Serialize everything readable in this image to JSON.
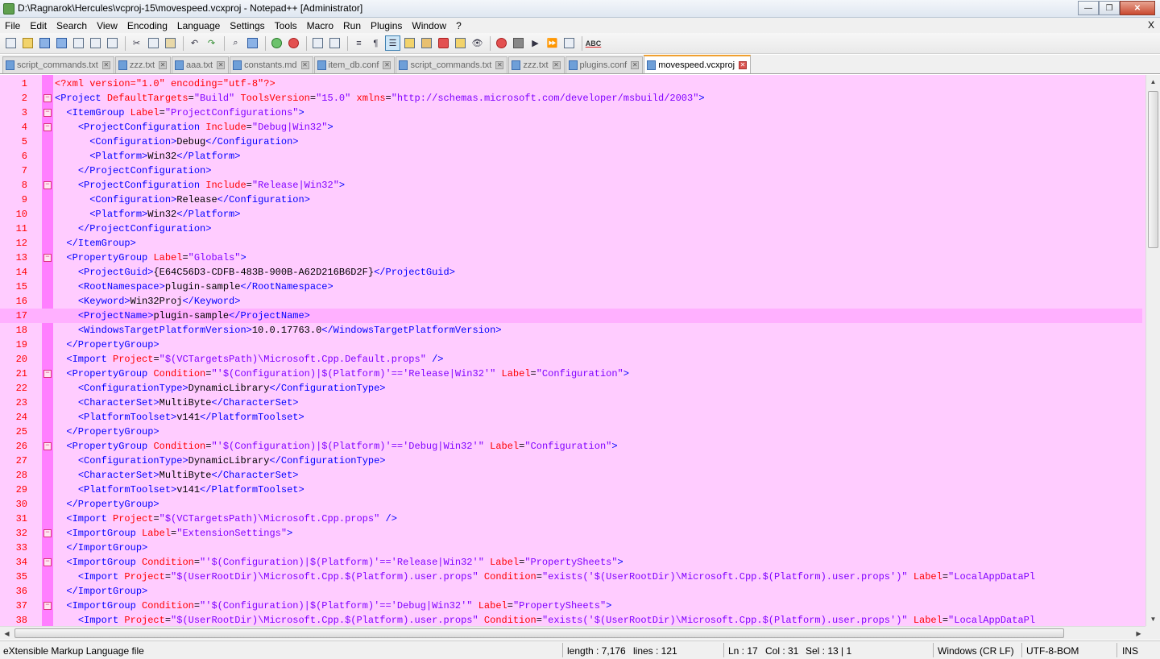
{
  "window": {
    "title": "D:\\Ragnarok\\Hercules\\vcproj-15\\movespeed.vcxproj - Notepad++ [Administrator]",
    "minimize": "—",
    "maximize": "❐",
    "close": "✕"
  },
  "menu": {
    "items": [
      "File",
      "Edit",
      "Search",
      "View",
      "Encoding",
      "Language",
      "Settings",
      "Tools",
      "Macro",
      "Run",
      "Plugins",
      "Window",
      "?"
    ],
    "close_doc": "X"
  },
  "toolbar": {
    "spellcheck_label": "ABC",
    "icons": [
      "new-file-icon",
      "open-file-icon",
      "save-icon",
      "save-all-icon",
      "close-icon",
      "close-all-icon",
      "print-icon",
      "cut-icon",
      "copy-icon",
      "paste-icon",
      "undo-icon",
      "redo-icon",
      "find-icon",
      "replace-icon",
      "zoom-in-icon",
      "zoom-out-icon",
      "sync-vertical-icon",
      "sync-horizontal-icon",
      "word-wrap-icon",
      "show-all-chars-icon",
      "indent-guide-icon",
      "user-language-icon",
      "doc-map-icon",
      "function-list-icon",
      "folder-workspace-icon",
      "monitoring-icon",
      "record-macro-icon",
      "stop-macro-icon",
      "play-macro-icon",
      "run-macro-multiple-icon",
      "save-macro-icon",
      "spell-check-icon"
    ]
  },
  "tabs": [
    {
      "label": "script_commands.txt",
      "active": false
    },
    {
      "label": "zzz.txt",
      "active": false
    },
    {
      "label": "aaa.txt",
      "active": false
    },
    {
      "label": "constants.md",
      "active": false
    },
    {
      "label": "item_db.conf",
      "active": false
    },
    {
      "label": "script_commands.txt",
      "active": false
    },
    {
      "label": "zzz.txt",
      "active": false
    },
    {
      "label": "plugins.conf",
      "active": false
    },
    {
      "label": "movespeed.vcxproj",
      "active": true
    }
  ],
  "editor": {
    "current_line": 17,
    "lines": [
      {
        "n": "1",
        "fold": "",
        "code": [
          [
            "pi",
            "<?xml version=\"1.0\" encoding=\"utf-8\"?>"
          ]
        ]
      },
      {
        "n": "2",
        "fold": "−",
        "code": [
          [
            "tag",
            "<Project "
          ],
          [
            "attr",
            "DefaultTargets"
          ],
          [
            "txt",
            "="
          ],
          [
            "str",
            "\"Build\""
          ],
          [
            "attr",
            " ToolsVersion"
          ],
          [
            "txt",
            "="
          ],
          [
            "str",
            "\"15.0\""
          ],
          [
            "attr",
            " xmlns"
          ],
          [
            "txt",
            "="
          ],
          [
            "str",
            "\"http://schemas.microsoft.com/developer/msbuild/2003\""
          ],
          [
            "tag",
            ">"
          ]
        ]
      },
      {
        "n": "3",
        "fold": "−",
        "code": [
          [
            "txt",
            "  "
          ],
          [
            "tag",
            "<ItemGroup "
          ],
          [
            "attr",
            "Label"
          ],
          [
            "txt",
            "="
          ],
          [
            "str",
            "\"ProjectConfigurations\""
          ],
          [
            "tag",
            ">"
          ]
        ]
      },
      {
        "n": "4",
        "fold": "−",
        "code": [
          [
            "txt",
            "    "
          ],
          [
            "tag",
            "<ProjectConfiguration "
          ],
          [
            "attr",
            "Include"
          ],
          [
            "txt",
            "="
          ],
          [
            "str",
            "\"Debug|Win32\""
          ],
          [
            "tag",
            ">"
          ]
        ]
      },
      {
        "n": "5",
        "fold": "",
        "code": [
          [
            "txt",
            "      "
          ],
          [
            "tag",
            "<Configuration>"
          ],
          [
            "txt",
            "Debug"
          ],
          [
            "tag",
            "</Configuration>"
          ]
        ]
      },
      {
        "n": "6",
        "fold": "",
        "code": [
          [
            "txt",
            "      "
          ],
          [
            "tag",
            "<Platform>"
          ],
          [
            "txt",
            "Win32"
          ],
          [
            "tag",
            "</Platform>"
          ]
        ]
      },
      {
        "n": "7",
        "fold": "",
        "code": [
          [
            "txt",
            "    "
          ],
          [
            "tag",
            "</ProjectConfiguration>"
          ]
        ]
      },
      {
        "n": "8",
        "fold": "−",
        "code": [
          [
            "txt",
            "    "
          ],
          [
            "tag",
            "<ProjectConfiguration "
          ],
          [
            "attr",
            "Include"
          ],
          [
            "txt",
            "="
          ],
          [
            "str",
            "\"Release|Win32\""
          ],
          [
            "tag",
            ">"
          ]
        ]
      },
      {
        "n": "9",
        "fold": "",
        "code": [
          [
            "txt",
            "      "
          ],
          [
            "tag",
            "<Configuration>"
          ],
          [
            "txt",
            "Release"
          ],
          [
            "tag",
            "</Configuration>"
          ]
        ]
      },
      {
        "n": "10",
        "fold": "",
        "code": [
          [
            "txt",
            "      "
          ],
          [
            "tag",
            "<Platform>"
          ],
          [
            "txt",
            "Win32"
          ],
          [
            "tag",
            "</Platform>"
          ]
        ]
      },
      {
        "n": "11",
        "fold": "",
        "code": [
          [
            "txt",
            "    "
          ],
          [
            "tag",
            "</ProjectConfiguration>"
          ]
        ]
      },
      {
        "n": "12",
        "fold": "",
        "code": [
          [
            "txt",
            "  "
          ],
          [
            "tag",
            "</ItemGroup>"
          ]
        ]
      },
      {
        "n": "13",
        "fold": "−",
        "code": [
          [
            "txt",
            "  "
          ],
          [
            "tag",
            "<PropertyGroup "
          ],
          [
            "attr",
            "Label"
          ],
          [
            "txt",
            "="
          ],
          [
            "str",
            "\"Globals\""
          ],
          [
            "tag",
            ">"
          ]
        ]
      },
      {
        "n": "14",
        "fold": "",
        "code": [
          [
            "txt",
            "    "
          ],
          [
            "tag",
            "<ProjectGuid>"
          ],
          [
            "txt",
            "{E64C56D3-CDFB-483B-900B-A62D216B6D2F}"
          ],
          [
            "tag",
            "</ProjectGuid>"
          ]
        ]
      },
      {
        "n": "15",
        "fold": "",
        "code": [
          [
            "txt",
            "    "
          ],
          [
            "tag",
            "<RootNamespace>"
          ],
          [
            "txt",
            "plugin-sample"
          ],
          [
            "tag",
            "</RootNamespace>"
          ]
        ]
      },
      {
        "n": "16",
        "fold": "",
        "code": [
          [
            "txt",
            "    "
          ],
          [
            "tag",
            "<Keyword>"
          ],
          [
            "txt",
            "Win32Proj"
          ],
          [
            "tag",
            "</Keyword>"
          ]
        ]
      },
      {
        "n": "17",
        "fold": "",
        "code": [
          [
            "txt",
            "    "
          ],
          [
            "tag",
            "<ProjectName>"
          ],
          [
            "txt",
            "plugin-sample"
          ],
          [
            "tag",
            "</ProjectName>"
          ]
        ]
      },
      {
        "n": "18",
        "fold": "",
        "code": [
          [
            "txt",
            "    "
          ],
          [
            "tag",
            "<WindowsTargetPlatformVersion>"
          ],
          [
            "txt",
            "10.0.17763.0"
          ],
          [
            "tag",
            "</WindowsTargetPlatformVersion>"
          ]
        ]
      },
      {
        "n": "19",
        "fold": "",
        "code": [
          [
            "txt",
            "  "
          ],
          [
            "tag",
            "</PropertyGroup>"
          ]
        ]
      },
      {
        "n": "20",
        "fold": "",
        "code": [
          [
            "txt",
            "  "
          ],
          [
            "tag",
            "<Import "
          ],
          [
            "attr",
            "Project"
          ],
          [
            "txt",
            "="
          ],
          [
            "str",
            "\"$(VCTargetsPath)\\Microsoft.Cpp.Default.props\""
          ],
          [
            "tag",
            " />"
          ]
        ]
      },
      {
        "n": "21",
        "fold": "−",
        "code": [
          [
            "txt",
            "  "
          ],
          [
            "tag",
            "<PropertyGroup "
          ],
          [
            "attr",
            "Condition"
          ],
          [
            "txt",
            "="
          ],
          [
            "str",
            "\"'$(Configuration)|$(Platform)'=='Release|Win32'\""
          ],
          [
            "attr",
            " Label"
          ],
          [
            "txt",
            "="
          ],
          [
            "str",
            "\"Configuration\""
          ],
          [
            "tag",
            ">"
          ]
        ]
      },
      {
        "n": "22",
        "fold": "",
        "code": [
          [
            "txt",
            "    "
          ],
          [
            "tag",
            "<ConfigurationType>"
          ],
          [
            "txt",
            "DynamicLibrary"
          ],
          [
            "tag",
            "</ConfigurationType>"
          ]
        ]
      },
      {
        "n": "23",
        "fold": "",
        "code": [
          [
            "txt",
            "    "
          ],
          [
            "tag",
            "<CharacterSet>"
          ],
          [
            "txt",
            "MultiByte"
          ],
          [
            "tag",
            "</CharacterSet>"
          ]
        ]
      },
      {
        "n": "24",
        "fold": "",
        "code": [
          [
            "txt",
            "    "
          ],
          [
            "tag",
            "<PlatformToolset>"
          ],
          [
            "txt",
            "v141"
          ],
          [
            "tag",
            "</PlatformToolset>"
          ]
        ]
      },
      {
        "n": "25",
        "fold": "",
        "code": [
          [
            "txt",
            "  "
          ],
          [
            "tag",
            "</PropertyGroup>"
          ]
        ]
      },
      {
        "n": "26",
        "fold": "−",
        "code": [
          [
            "txt",
            "  "
          ],
          [
            "tag",
            "<PropertyGroup "
          ],
          [
            "attr",
            "Condition"
          ],
          [
            "txt",
            "="
          ],
          [
            "str",
            "\"'$(Configuration)|$(Platform)'=='Debug|Win32'\""
          ],
          [
            "attr",
            " Label"
          ],
          [
            "txt",
            "="
          ],
          [
            "str",
            "\"Configuration\""
          ],
          [
            "tag",
            ">"
          ]
        ]
      },
      {
        "n": "27",
        "fold": "",
        "code": [
          [
            "txt",
            "    "
          ],
          [
            "tag",
            "<ConfigurationType>"
          ],
          [
            "txt",
            "DynamicLibrary"
          ],
          [
            "tag",
            "</ConfigurationType>"
          ]
        ]
      },
      {
        "n": "28",
        "fold": "",
        "code": [
          [
            "txt",
            "    "
          ],
          [
            "tag",
            "<CharacterSet>"
          ],
          [
            "txt",
            "MultiByte"
          ],
          [
            "tag",
            "</CharacterSet>"
          ]
        ]
      },
      {
        "n": "29",
        "fold": "",
        "code": [
          [
            "txt",
            "    "
          ],
          [
            "tag",
            "<PlatformToolset>"
          ],
          [
            "txt",
            "v141"
          ],
          [
            "tag",
            "</PlatformToolset>"
          ]
        ]
      },
      {
        "n": "30",
        "fold": "",
        "code": [
          [
            "txt",
            "  "
          ],
          [
            "tag",
            "</PropertyGroup>"
          ]
        ]
      },
      {
        "n": "31",
        "fold": "",
        "code": [
          [
            "txt",
            "  "
          ],
          [
            "tag",
            "<Import "
          ],
          [
            "attr",
            "Project"
          ],
          [
            "txt",
            "="
          ],
          [
            "str",
            "\"$(VCTargetsPath)\\Microsoft.Cpp.props\""
          ],
          [
            "tag",
            " />"
          ]
        ]
      },
      {
        "n": "32",
        "fold": "−",
        "code": [
          [
            "txt",
            "  "
          ],
          [
            "tag",
            "<ImportGroup "
          ],
          [
            "attr",
            "Label"
          ],
          [
            "txt",
            "="
          ],
          [
            "str",
            "\"ExtensionSettings\""
          ],
          [
            "tag",
            ">"
          ]
        ]
      },
      {
        "n": "33",
        "fold": "",
        "code": [
          [
            "txt",
            "  "
          ],
          [
            "tag",
            "</ImportGroup>"
          ]
        ]
      },
      {
        "n": "34",
        "fold": "−",
        "code": [
          [
            "txt",
            "  "
          ],
          [
            "tag",
            "<ImportGroup "
          ],
          [
            "attr",
            "Condition"
          ],
          [
            "txt",
            "="
          ],
          [
            "str",
            "\"'$(Configuration)|$(Platform)'=='Release|Win32'\""
          ],
          [
            "attr",
            " Label"
          ],
          [
            "txt",
            "="
          ],
          [
            "str",
            "\"PropertySheets\""
          ],
          [
            "tag",
            ">"
          ]
        ]
      },
      {
        "n": "35",
        "fold": "",
        "code": [
          [
            "txt",
            "    "
          ],
          [
            "tag",
            "<Import "
          ],
          [
            "attr",
            "Project"
          ],
          [
            "txt",
            "="
          ],
          [
            "str",
            "\"$(UserRootDir)\\Microsoft.Cpp.$(Platform).user.props\""
          ],
          [
            "attr",
            " Condition"
          ],
          [
            "txt",
            "="
          ],
          [
            "str",
            "\"exists('$(UserRootDir)\\Microsoft.Cpp.$(Platform).user.props')\""
          ],
          [
            "attr",
            " Label"
          ],
          [
            "txt",
            "="
          ],
          [
            "str",
            "\"LocalAppDataPl"
          ]
        ]
      },
      {
        "n": "36",
        "fold": "",
        "code": [
          [
            "txt",
            "  "
          ],
          [
            "tag",
            "</ImportGroup>"
          ]
        ]
      },
      {
        "n": "37",
        "fold": "−",
        "code": [
          [
            "txt",
            "  "
          ],
          [
            "tag",
            "<ImportGroup "
          ],
          [
            "attr",
            "Condition"
          ],
          [
            "txt",
            "="
          ],
          [
            "str",
            "\"'$(Configuration)|$(Platform)'=='Debug|Win32'\""
          ],
          [
            "attr",
            " Label"
          ],
          [
            "txt",
            "="
          ],
          [
            "str",
            "\"PropertySheets\""
          ],
          [
            "tag",
            ">"
          ]
        ]
      },
      {
        "n": "38",
        "fold": "",
        "code": [
          [
            "txt",
            "    "
          ],
          [
            "tag",
            "<Import "
          ],
          [
            "attr",
            "Project"
          ],
          [
            "txt",
            "="
          ],
          [
            "str",
            "\"$(UserRootDir)\\Microsoft.Cpp.$(Platform).user.props\""
          ],
          [
            "attr",
            " Condition"
          ],
          [
            "txt",
            "="
          ],
          [
            "str",
            "\"exists('$(UserRootDir)\\Microsoft.Cpp.$(Platform).user.props')\""
          ],
          [
            "attr",
            " Label"
          ],
          [
            "txt",
            "="
          ],
          [
            "str",
            "\"LocalAppDataPl"
          ]
        ]
      }
    ]
  },
  "status": {
    "file_type": "eXtensible Markup Language file",
    "length": "length : 7,176",
    "lines": "lines : 121",
    "ln": "Ln : 17",
    "col": "Col : 31",
    "sel": "Sel : 13 | 1",
    "eol": "Windows (CR LF)",
    "encoding": "UTF-8-BOM",
    "mode": "INS"
  },
  "colors": {
    "editor_bg": "#ffccff",
    "fold_margin": "#ff7fff",
    "line_number": "#ff0000",
    "tag": "#0000ff",
    "attribute": "#ff0000",
    "string": "#8000ff",
    "current_line": "#ffb0ff"
  }
}
